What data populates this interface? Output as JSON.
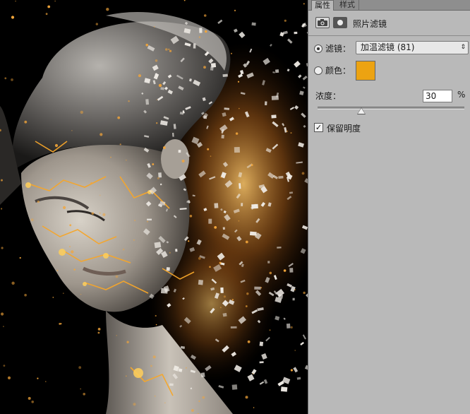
{
  "panel": {
    "tabs": [
      {
        "label": "属性",
        "active": true
      },
      {
        "label": "样式",
        "active": false
      }
    ],
    "adjustment_title": "照片滤镜",
    "header_icons": [
      "camera-adjustment-icon",
      "layer-mask-icon"
    ],
    "filter": {
      "label": "滤镜：",
      "selected": true,
      "value": "加温滤镜 (81)"
    },
    "color": {
      "label": "颜色：",
      "selected": false,
      "swatch": "#eca312"
    },
    "density": {
      "label": "浓度：",
      "value": "30",
      "unit": "%",
      "fraction": 0.3
    },
    "preserve_luminosity": {
      "label": "保留明度",
      "checked": true,
      "check_glyph": "✓"
    }
  },
  "canvas": {
    "background": "#000000",
    "subject": "dispersion-portrait",
    "accent": "#e89a2a"
  }
}
